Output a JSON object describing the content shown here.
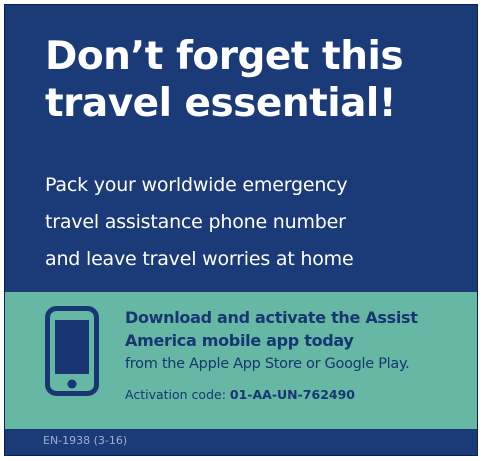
{
  "colors": {
    "navy": "#1b3a78",
    "teal": "#66b7a3",
    "headline_text": "#ffffff",
    "band_text": "#173672"
  },
  "headline": {
    "line1": "Don’t forget this",
    "line2": "travel essential!"
  },
  "subhead": {
    "line1": "Pack your worldwide emergency",
    "line2": "travel assistance phone number",
    "line3": "and leave travel worries at home"
  },
  "promo": {
    "icon": "smartphone-icon",
    "title_line1": "Download and activate the Assist",
    "title_line2": "America mobile app today",
    "subtitle": "from the Apple App Store or Google Play.",
    "activation_label": "Activation code: ",
    "activation_code": "01-AA-UN-762490"
  },
  "footer": {
    "form_number": "EN-1938 (3-16)"
  }
}
